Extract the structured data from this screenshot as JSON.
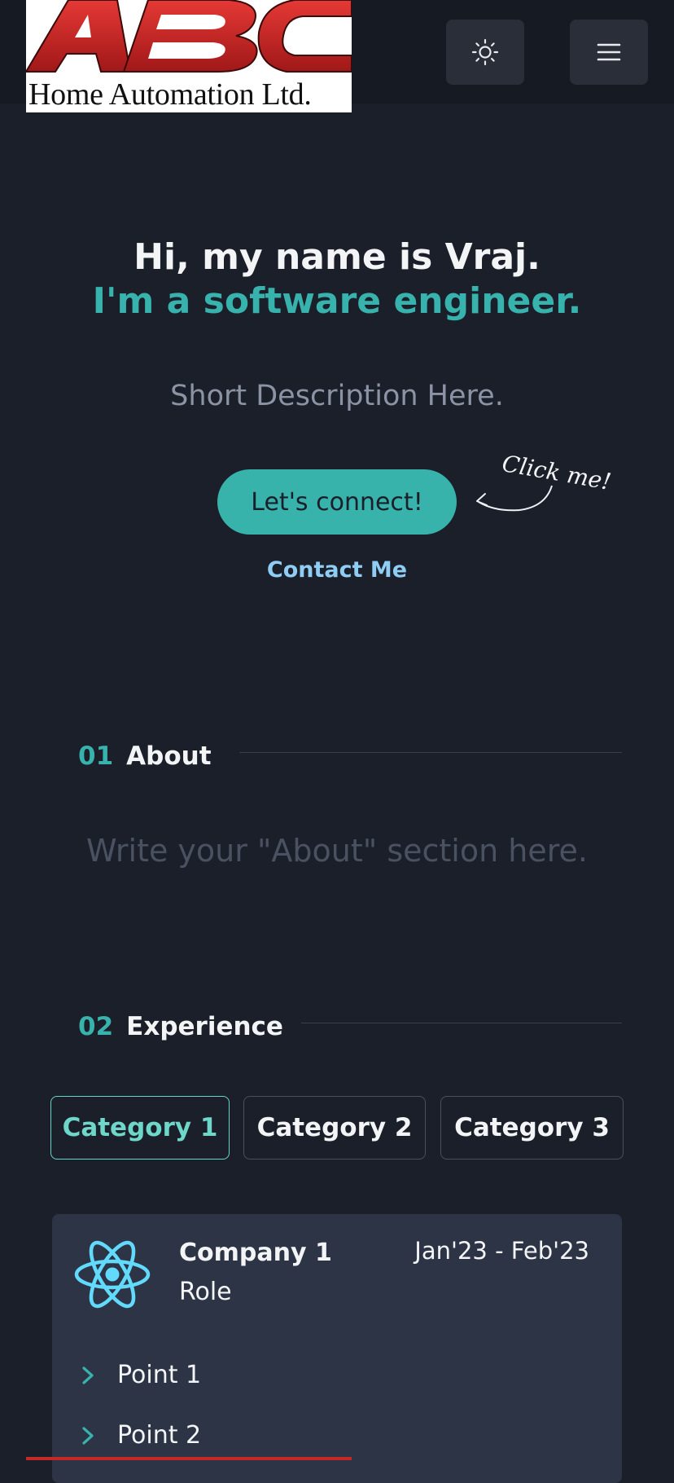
{
  "header": {
    "logo_text": "Home Automation Ltd.",
    "logo_letters": "ABC",
    "theme_icon": "sun-icon",
    "menu_icon": "hamburger-menu-icon"
  },
  "hero": {
    "greeting": "Hi, my name is Vraj.",
    "tagline": "I'm a software engineer.",
    "description": "Short Description Here.",
    "cta_label": "Let's connect!",
    "cta_note": "Click me!",
    "contact_link": "Contact Me"
  },
  "about": {
    "number": "01",
    "title": "About",
    "body": "Write your \"About\" section here."
  },
  "experience": {
    "number": "02",
    "title": "Experience",
    "tabs": [
      {
        "label": "Category 1",
        "active": true
      },
      {
        "label": "Category 2",
        "active": false
      },
      {
        "label": "Category 3",
        "active": false
      }
    ],
    "card": {
      "icon": "react-icon",
      "company": "Company 1",
      "role": "Role",
      "dates": "Jan'23 - Feb'23",
      "points": [
        "Point 1",
        "Point 2"
      ]
    }
  },
  "colors": {
    "background": "#1b1f2a",
    "accent": "#38b2ac",
    "link": "#90cdf4",
    "card": "#2d3446"
  }
}
